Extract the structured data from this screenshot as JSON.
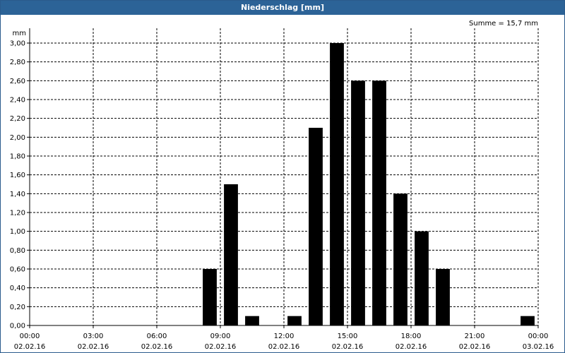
{
  "title": "Niederschlag [mm]",
  "summary": "Summe = 15,7 mm",
  "colors": {
    "title_bg": "#2c6397",
    "bar": "#000000"
  },
  "chart_data": {
    "type": "bar",
    "title": "Niederschlag [mm]",
    "ylabel": "mm",
    "ylim": [
      0,
      3.0
    ],
    "y_ticks": [
      "0,00",
      "0,20",
      "0,40",
      "0,60",
      "0,80",
      "1,00",
      "1,20",
      "1,40",
      "1,60",
      "1,80",
      "2,00",
      "2,20",
      "2,40",
      "2,60",
      "2,80",
      "3,00"
    ],
    "x_ticks": [
      {
        "time": "00:00",
        "date": "02.02.16"
      },
      {
        "time": "03:00",
        "date": "02.02.16"
      },
      {
        "time": "06:00",
        "date": "02.02.16"
      },
      {
        "time": "09:00",
        "date": "02.02.16"
      },
      {
        "time": "12:00",
        "date": "02.02.16"
      },
      {
        "time": "15:00",
        "date": "02.02.16"
      },
      {
        "time": "18:00",
        "date": "02.02.16"
      },
      {
        "time": "21:00",
        "date": "02.02.16"
      },
      {
        "time": "00:00",
        "date": "03.02.16"
      }
    ],
    "bars": [
      {
        "hour": 9,
        "value": 0.6
      },
      {
        "hour": 10,
        "value": 1.5
      },
      {
        "hour": 11,
        "value": 0.1
      },
      {
        "hour": 13,
        "value": 0.1
      },
      {
        "hour": 14,
        "value": 2.1
      },
      {
        "hour": 15,
        "value": 3.0
      },
      {
        "hour": 16,
        "value": 2.6
      },
      {
        "hour": 17,
        "value": 2.6
      },
      {
        "hour": 18,
        "value": 1.4
      },
      {
        "hour": 19,
        "value": 1.0
      },
      {
        "hour": 20,
        "value": 0.6
      },
      {
        "hour": 24,
        "value": 0.1
      }
    ],
    "grid": true
  }
}
